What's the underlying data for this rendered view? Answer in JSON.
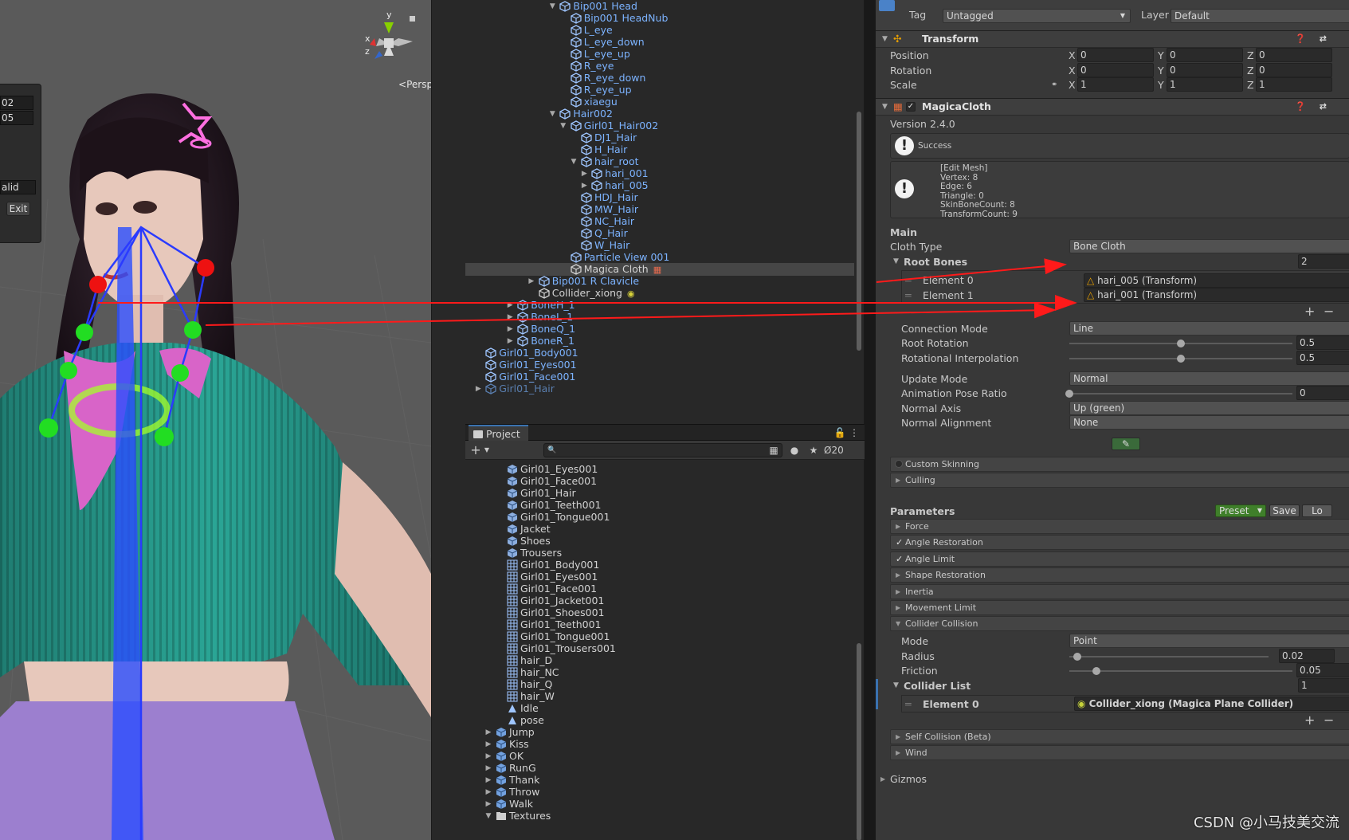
{
  "scene": {
    "persp_label": "Persp",
    "tools": {
      "field_1": "02",
      "field_2": "05",
      "status": "alid",
      "exit_label": "Exit"
    },
    "gizmo": {
      "y": "y",
      "x": "x",
      "z": "z"
    }
  },
  "hierarchy": {
    "rows": [
      {
        "label": "Bip001 Head",
        "color": "blue",
        "arrow": "down"
      },
      {
        "label": "Bip001 HeadNub",
        "color": "blue"
      },
      {
        "label": "L_eye",
        "color": "blue"
      },
      {
        "label": "L_eye_down",
        "color": "blue"
      },
      {
        "label": "L_eye_up",
        "color": "blue"
      },
      {
        "label": "R_eye",
        "color": "blue"
      },
      {
        "label": "R_eye_down",
        "color": "blue"
      },
      {
        "label": "R_eye_up",
        "color": "blue"
      },
      {
        "label": "xiaegu",
        "color": "blue"
      },
      {
        "label": "Hair002",
        "color": "blue",
        "arrow": "down"
      },
      {
        "label": "Girl01_Hair002",
        "color": "blue",
        "arrow": "down"
      },
      {
        "label": "DJ1_Hair",
        "color": "blue"
      },
      {
        "label": "H_Hair",
        "color": "blue"
      },
      {
        "label": "hair_root",
        "color": "blue",
        "arrow": "down"
      },
      {
        "label": "hari_001",
        "color": "blue",
        "arrow": "right"
      },
      {
        "label": "hari_005",
        "color": "blue",
        "arrow": "right"
      },
      {
        "label": "HDJ_Hair",
        "color": "blue"
      },
      {
        "label": "MW_Hair",
        "color": "blue"
      },
      {
        "label": "NC_Hair",
        "color": "blue"
      },
      {
        "label": "Q_Hair",
        "color": "blue"
      },
      {
        "label": "W_Hair",
        "color": "blue"
      },
      {
        "label": "Particle View 001",
        "color": "blue"
      },
      {
        "label": "Magica Cloth",
        "color": "white"
      },
      {
        "label": "Bip001 R Clavicle",
        "color": "blue",
        "arrow": "right"
      },
      {
        "label": "Collider_xiong",
        "color": "white"
      },
      {
        "label": "BoneH_1",
        "color": "blue",
        "arrow": "right"
      },
      {
        "label": "BoneL_1",
        "color": "blue",
        "arrow": "right"
      },
      {
        "label": "BoneQ_1",
        "color": "blue",
        "arrow": "right"
      },
      {
        "label": "BoneR_1",
        "color": "blue",
        "arrow": "right"
      },
      {
        "label": "Girl01_Body001",
        "color": "blue"
      },
      {
        "label": "Girl01_Eyes001",
        "color": "blue"
      },
      {
        "label": "Girl01_Face001",
        "color": "blue"
      },
      {
        "label": "Girl01_Hair",
        "color": "faded",
        "arrow": "right"
      }
    ]
  },
  "project": {
    "tab_label": "Project",
    "hidden_count": "20",
    "search_placeholder": "",
    "rows": [
      {
        "label": "Girl01_Eyes001",
        "icon": "mesh"
      },
      {
        "label": "Girl01_Face001",
        "icon": "mesh"
      },
      {
        "label": "Girl01_Hair",
        "icon": "mesh"
      },
      {
        "label": "Girl01_Teeth001",
        "icon": "mesh"
      },
      {
        "label": "Girl01_Tongue001",
        "icon": "mesh"
      },
      {
        "label": "Jacket",
        "icon": "mesh"
      },
      {
        "label": "Shoes",
        "icon": "mesh"
      },
      {
        "label": "Trousers",
        "icon": "mesh"
      },
      {
        "label": "Girl01_Body001",
        "icon": "grid"
      },
      {
        "label": "Girl01_Eyes001",
        "icon": "grid"
      },
      {
        "label": "Girl01_Face001",
        "icon": "grid"
      },
      {
        "label": "Girl01_Jacket001",
        "icon": "grid"
      },
      {
        "label": "Girl01_Shoes001",
        "icon": "grid"
      },
      {
        "label": "Girl01_Teeth001",
        "icon": "grid"
      },
      {
        "label": "Girl01_Tongue001",
        "icon": "grid"
      },
      {
        "label": "Girl01_Trousers001",
        "icon": "grid"
      },
      {
        "label": "hair_D",
        "icon": "grid"
      },
      {
        "label": "hair_NC",
        "icon": "grid"
      },
      {
        "label": "hair_Q",
        "icon": "grid"
      },
      {
        "label": "hair_W",
        "icon": "grid"
      },
      {
        "label": "Idle",
        "icon": "anim"
      },
      {
        "label": "pose",
        "icon": "anim"
      },
      {
        "label": "Jump",
        "icon": "prefab",
        "arrow": "right"
      },
      {
        "label": "Kiss",
        "icon": "prefab",
        "arrow": "right"
      },
      {
        "label": "OK",
        "icon": "prefab",
        "arrow": "right"
      },
      {
        "label": "RunG",
        "icon": "prefab",
        "arrow": "right"
      },
      {
        "label": "Thank",
        "icon": "prefab",
        "arrow": "right"
      },
      {
        "label": "Throw",
        "icon": "prefab",
        "arrow": "right"
      },
      {
        "label": "Walk",
        "icon": "prefab",
        "arrow": "right"
      },
      {
        "label": "Textures",
        "icon": "folder",
        "arrow": "down"
      }
    ]
  },
  "inspector": {
    "tag_label": "Tag",
    "tag_value": "Untagged",
    "layer_label": "Layer",
    "layer_value": "Default",
    "transform": {
      "title": "Transform",
      "position_label": "Position",
      "rotation_label": "Rotation",
      "scale_label": "Scale",
      "axis_x": "X",
      "axis_y": "Y",
      "axis_z": "Z",
      "position": [
        "0",
        "0",
        "0"
      ],
      "rotation": [
        "0",
        "0",
        "0"
      ],
      "scale": [
        "1",
        "1",
        "1"
      ]
    },
    "magica": {
      "title": "MagicaCloth",
      "version": "Version 2.4.0",
      "success": "Success",
      "mesh_info": "[Edit Mesh]\nVertex: 8\nEdge: 6\nTriangle: 0\nSkinBoneCount: 8\nTransformCount: 9",
      "main_label": "Main",
      "cloth_type_label": "Cloth Type",
      "cloth_type_value": "Bone Cloth",
      "root_bones_label": "Root Bones",
      "root_bones_count": "2",
      "element0_label": "Element 0",
      "element0_value": "hari_005 (Transform)",
      "element1_label": "Element 1",
      "element1_value": "hari_001 (Transform)",
      "connection_mode_label": "Connection Mode",
      "connection_mode_value": "Line",
      "root_rotation_label": "Root Rotation",
      "root_rotation_value": "0.5",
      "rot_interp_label": "Rotational Interpolation",
      "rot_interp_value": "0.5",
      "update_mode_label": "Update Mode",
      "update_mode_value": "Normal",
      "anim_pose_label": "Animation Pose Ratio",
      "anim_pose_value": "0",
      "normal_axis_label": "Normal Axis",
      "normal_axis_value": "Up (green)",
      "normal_align_label": "Normal Alignment",
      "normal_align_value": "None",
      "custom_skinning": "Custom Skinning",
      "culling": "Culling",
      "parameters_label": "Parameters",
      "preset_label": "Preset",
      "save_label": "Save",
      "load_label": "Lo",
      "force": "Force",
      "angle_restoration": "Angle Restoration",
      "angle_limit": "Angle Limit",
      "shape_restoration": "Shape Restoration",
      "inertia": "Inertia",
      "movement_limit": "Movement Limit",
      "collider_collision": "Collider Collision",
      "mode_label": "Mode",
      "mode_value": "Point",
      "radius_label": "Radius",
      "radius_value": "0.02",
      "friction_label": "Friction",
      "friction_value": "0.05",
      "collider_list_label": "Collider List",
      "collider_list_count": "1",
      "collider_element0_label": "Element 0",
      "collider_element0_value": "Collider_xiong (Magica Plane Collider)",
      "self_collision": "Self Collision (Beta)",
      "wind": "Wind",
      "gizmos": "Gizmos"
    },
    "slider_ratios": {
      "root_rotation": 0.5,
      "rot_interp": 0.5,
      "anim_pose": 0.0,
      "radius": 0.04,
      "friction": 0.12
    }
  },
  "watermark": "CSDN @小马技美交流",
  "colors": {
    "accent_blue": "#7cb3ff",
    "arrow_red": "#ff1a1a",
    "bone_green": "#22dd22",
    "bone_red": "#ee1111",
    "bone_line": "#2a3bff",
    "preset_green": "#3f7f2a"
  }
}
